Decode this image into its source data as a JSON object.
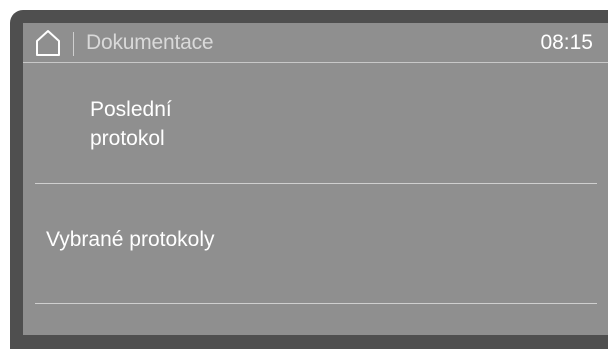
{
  "header": {
    "home_icon": "home-icon",
    "title": "Dokumentace",
    "time": "08:15"
  },
  "menu": {
    "items": [
      {
        "label_line1": "Poslední",
        "label_line2": "protokol"
      },
      {
        "label": "Vybrané protokoly"
      }
    ]
  },
  "colors": {
    "bezel": "#4f4f4f",
    "screen": "#8f8f8f",
    "text": "#ffffff",
    "divider": "#cfcfcf"
  }
}
